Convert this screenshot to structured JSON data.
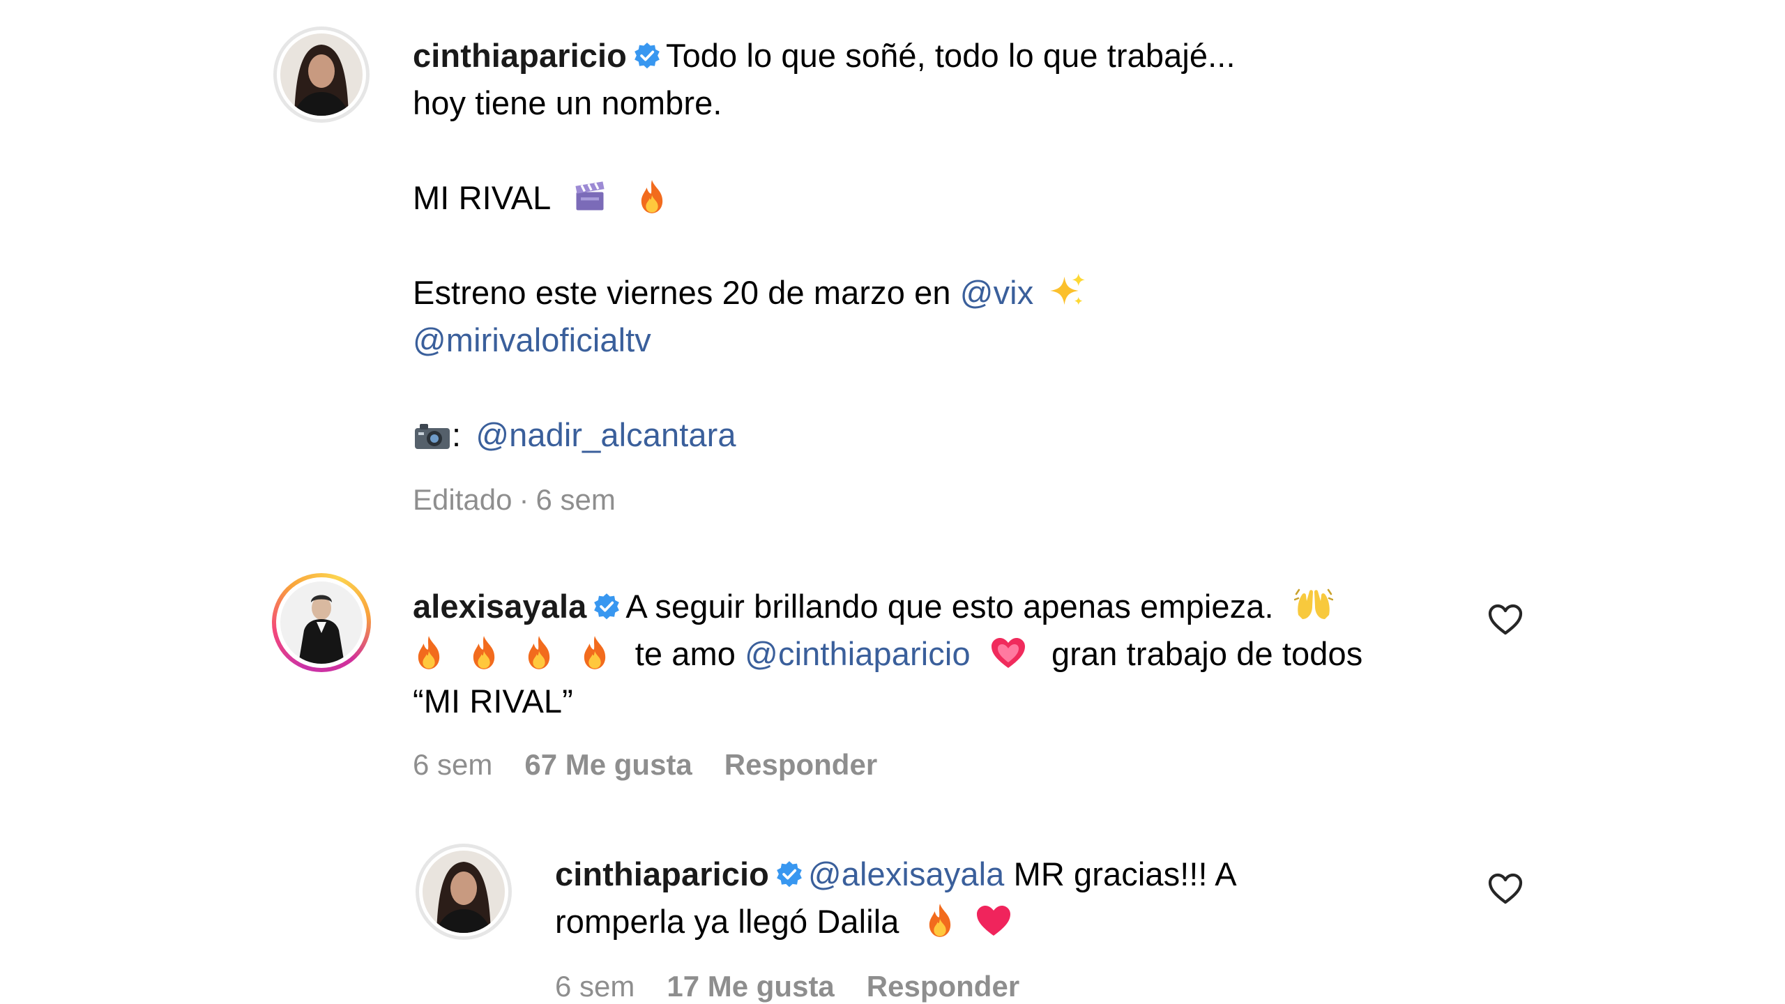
{
  "caption": {
    "username": "cinthiaparicio",
    "line1": "Todo lo que soñé, todo lo que trabajé...",
    "line2": "hoy tiene un nombre.",
    "title": "MI RIVAL",
    "estreno_text": "Estreno este viernes 20 de marzo en",
    "estreno_mention": "@vix",
    "mention_show": "@mirivaloficialtv",
    "photo_colon": ":",
    "photo_mention": "@nadir_alcantara",
    "meta_edited": "Editado",
    "meta_sep": "·",
    "meta_time": "6 sem"
  },
  "comment1": {
    "username": "alexisayala",
    "text1": "A seguir brillando que esto apenas empieza.",
    "text2_before": "te amo",
    "mention": "@cinthiaparicio",
    "text2_after": "gran trabajo de todos",
    "text3": "“MI RIVAL”",
    "time": "6 sem",
    "likes": "67 Me gusta",
    "reply": "Responder"
  },
  "reply1": {
    "username": "cinthiaparicio",
    "mention": "@alexisayala",
    "text1": "MR gracias!!! A",
    "text2": "romperla ya llegó Dalila",
    "time": "6 sem",
    "likes": "17 Me gusta",
    "reply": "Responder"
  },
  "colors": {
    "mention": "#3a5f9b",
    "meta": "#8e8e8e",
    "verified": "#3897f0"
  },
  "icons": [
    "verified-badge-icon",
    "clapperboard-icon",
    "fire-icon",
    "sparkles-icon",
    "camera-icon",
    "raising-hands-icon",
    "heart-emoji-icon",
    "heart-outline-icon"
  ]
}
